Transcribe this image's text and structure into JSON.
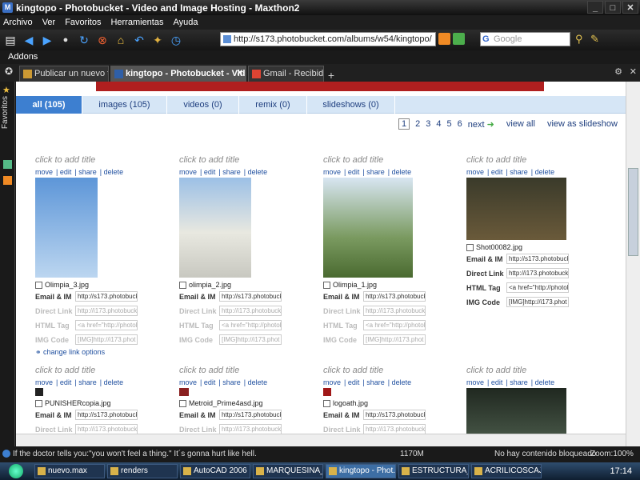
{
  "window": {
    "title": "kingtopo - Photobucket - Video and Image Hosting - Maxthon2"
  },
  "menu": [
    "Archivo",
    "Ver",
    "Favoritos",
    "Herramientas",
    "Ayuda"
  ],
  "address": {
    "url": "http://s173.photobucket.com/albums/w54/kingtopo/"
  },
  "search": {
    "placeholder": "Google"
  },
  "addons_label": "Addons",
  "tabs": [
    {
      "label": "Publicar un nuevo tema"
    },
    {
      "label": "kingtopo - Photobucket - Vid..."
    },
    {
      "label": "Gmail - Recibidos"
    }
  ],
  "sidebar": {
    "label": "Favoritos"
  },
  "subnav": [
    "all (105)",
    "images (105)",
    "videos (0)",
    "remix (0)",
    "slideshows (0)"
  ],
  "pager": {
    "pages": [
      "1",
      "2",
      "3",
      "4",
      "5",
      "6"
    ],
    "next": "next",
    "view_all": "view all",
    "slideshow": "view as slideshow"
  },
  "photo_common": {
    "title": "click to add title",
    "actions": [
      "move",
      "edit",
      "share",
      "delete"
    ],
    "labels": {
      "email": "Email & IM",
      "direct": "Direct Link",
      "html": "HTML Tag",
      "img": "IMG Code"
    },
    "values": {
      "email": "http://s173.photobuck",
      "direct": "http://i173.photobuck",
      "html": "<a href=\"http://photol",
      "img": "[IMG]http://i173.phot"
    }
  },
  "photos_row1": [
    {
      "name": "Olimpia_3.jpg"
    },
    {
      "name": "olimpia_2.jpg"
    },
    {
      "name": "Olimpia_1.jpg"
    },
    {
      "name": "Shot00082.jpg"
    }
  ],
  "photos_row2": [
    {
      "name": "PUNISHERcopia.jpg"
    },
    {
      "name": "Metroid_Prime4asd.jpg"
    },
    {
      "name": "logoath.jpg"
    },
    {
      "name": ""
    }
  ],
  "change_link": "change link options",
  "status": {
    "message": "If the doctor tells you:\"you won't feel a thing.\" It´s gonna hurt like hell.",
    "mem": "1170M",
    "blocked": "No hay contenido bloqueado",
    "zoom": "Zoom:100%"
  },
  "taskbar": {
    "items": [
      "nuevo.max",
      "renders",
      "AutoCAD 2006 ...",
      "MARQUESINA_...",
      "kingtopo - Phot...",
      "ESTRUCTURA_...",
      "ACRILICOSCAJ..."
    ],
    "clock": "17:14"
  }
}
